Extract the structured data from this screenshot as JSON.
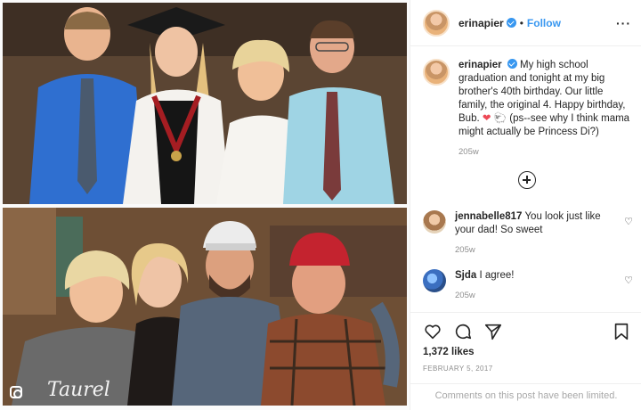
{
  "post": {
    "username": "erinapier",
    "follow_label": "Follow",
    "more_label": "···",
    "caption": {
      "username": "erinapier",
      "text_before_emoji": "My high school graduation and tonight at my big brother's 40th birthday. Our little family, the original 4. Happy birthday, Bub.",
      "emoji": "❤ 🐑",
      "text_after_emoji": "(ps--see why I think mama might actually be Princess Di?)",
      "time": "205w"
    },
    "comments": [
      {
        "username": "jennabelle817",
        "text": "You look just like your dad! So sweet",
        "time": "205w"
      },
      {
        "username": "Sjda",
        "text": "I agree!",
        "time": "205w"
      }
    ],
    "likes": "1,372 likes",
    "date": "FEBRUARY 5, 2017",
    "comments_limited": "Comments on this post have been limited."
  },
  "photo": {
    "sweatshirt_text": "Taurel",
    "icons": [
      "instagram-icon"
    ]
  },
  "colors": {
    "accent": "#3897f0",
    "heart": "#ed4956",
    "muted": "#8e8e8e"
  },
  "icons": [
    "heart-icon",
    "comment-icon",
    "share-icon",
    "bookmark-icon",
    "add-circle-icon",
    "verified-icon",
    "more-icon"
  ]
}
